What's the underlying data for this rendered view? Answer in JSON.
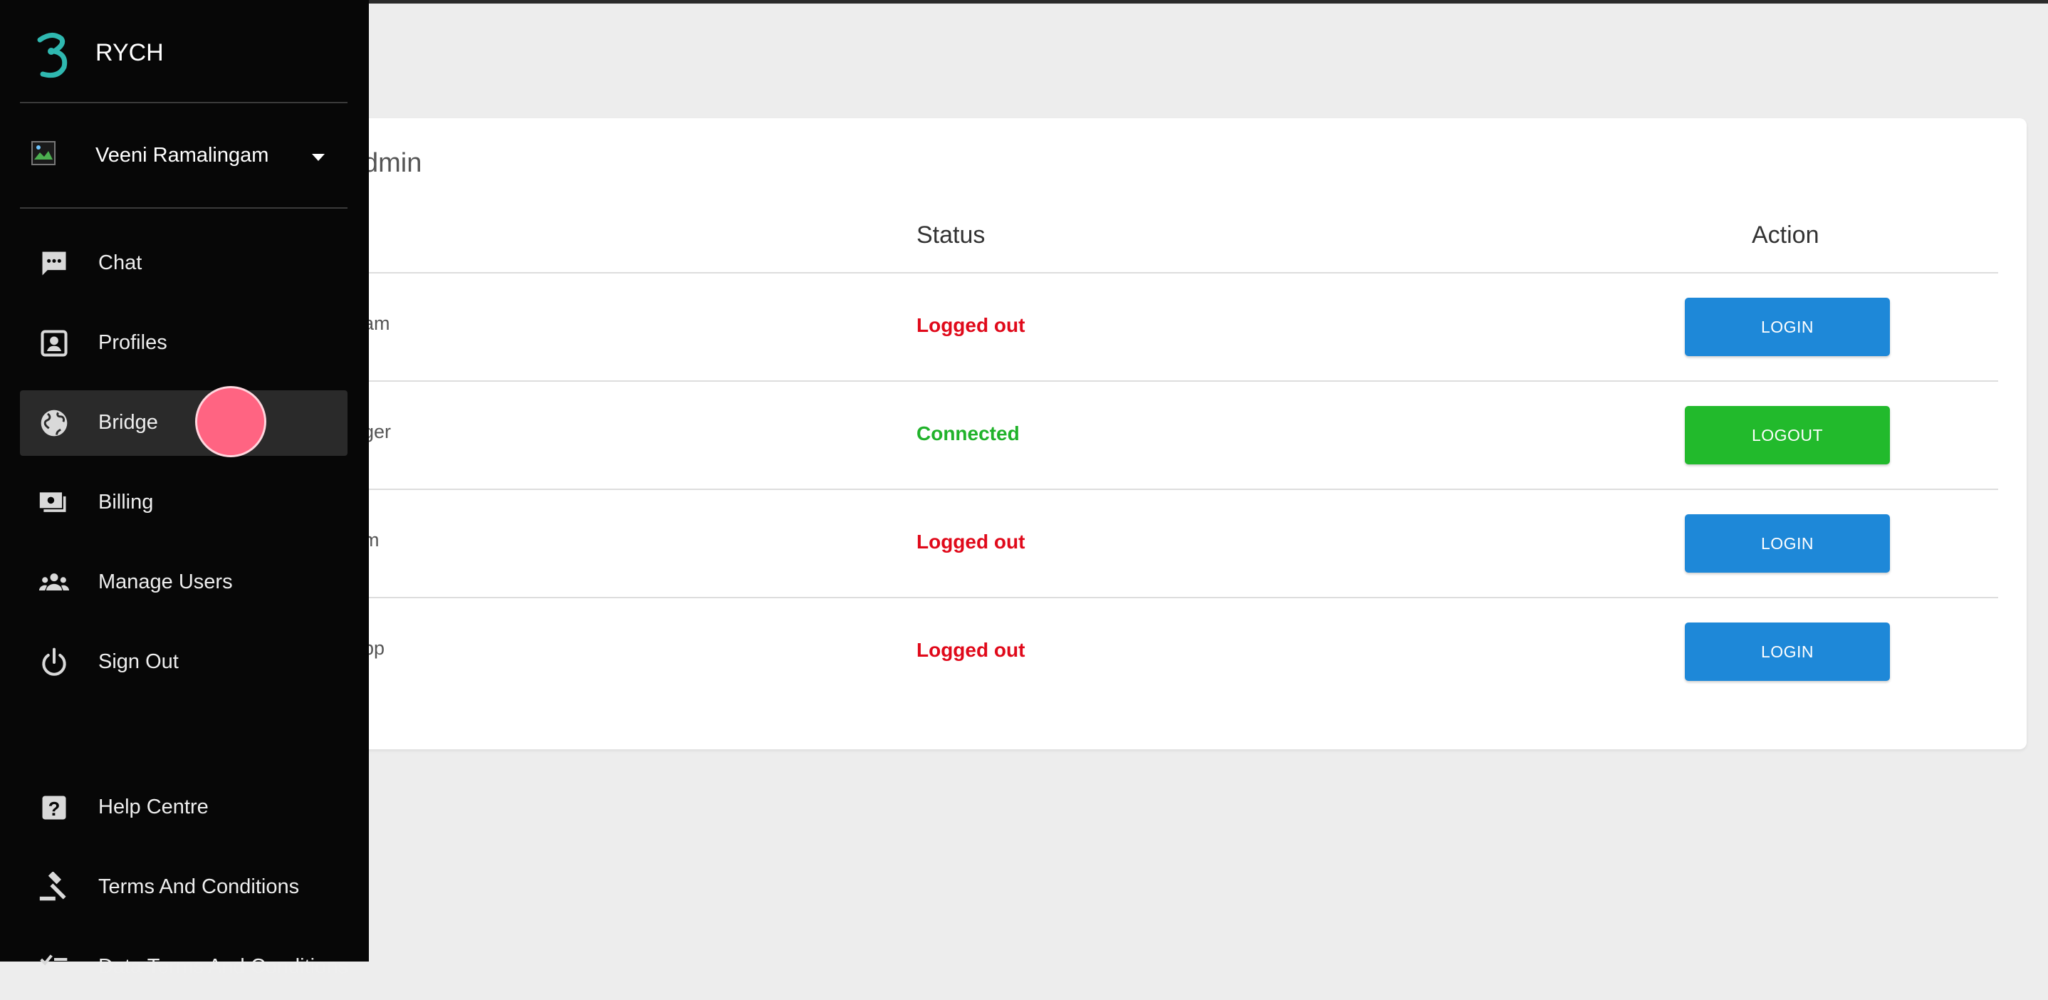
{
  "app": {
    "name": "RYCH"
  },
  "user": {
    "name": "Veeni Ramalingam"
  },
  "nav": {
    "items": [
      {
        "label": "Chat",
        "icon": "chat-icon"
      },
      {
        "label": "Profiles",
        "icon": "profile-icon"
      },
      {
        "label": "Bridge",
        "icon": "globe-icon",
        "active": true
      },
      {
        "label": "Billing",
        "icon": "billing-icon"
      },
      {
        "label": "Manage Users",
        "icon": "users-icon"
      },
      {
        "label": "Sign Out",
        "icon": "power-icon"
      }
    ],
    "bottom_items": [
      {
        "label": "Help Centre",
        "icon": "help-icon"
      },
      {
        "label": "Terms And Conditions",
        "icon": "gavel-icon"
      },
      {
        "label": "Data Terms And Conditions",
        "icon": "checklist-icon"
      }
    ]
  },
  "main": {
    "title": "dmin",
    "columns": {
      "status": "Status",
      "action": "Action"
    },
    "rows": [
      {
        "name": "am",
        "status": "Logged out",
        "action": "LOGIN"
      },
      {
        "name": "ger",
        "status": "Connected",
        "action": "LOGOUT"
      },
      {
        "name": "m",
        "status": "Logged out",
        "action": "LOGIN"
      },
      {
        "name": "pp",
        "status": "Logged out",
        "action": "LOGIN"
      }
    ]
  },
  "colors": {
    "brand_teal": "#2fb8b0",
    "logged_out": "#e0091a",
    "connected": "#20b22a",
    "login_button": "#1e88d8",
    "logout_button": "#22ba2c",
    "touch_indicator": "#ff6482"
  }
}
